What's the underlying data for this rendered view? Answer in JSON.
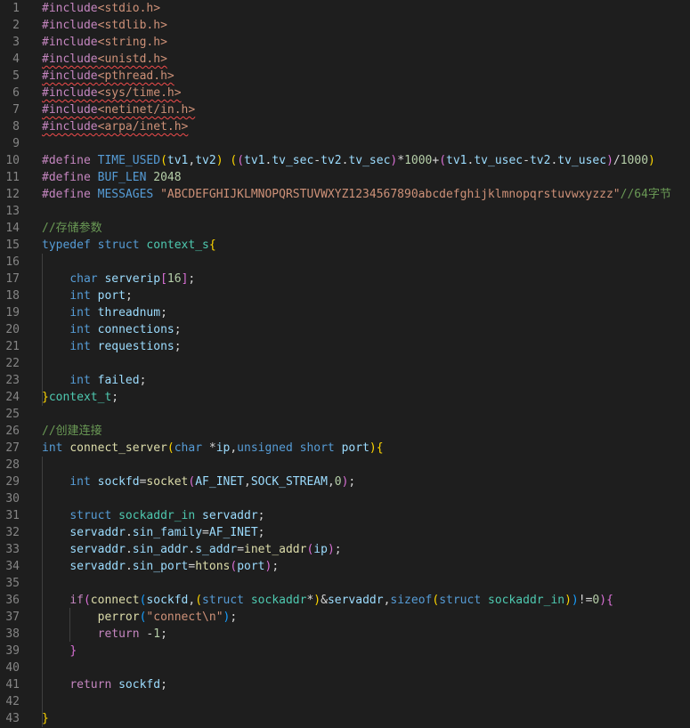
{
  "editor": {
    "colors": {
      "background": "#1e1e1e",
      "line_number": "#858585",
      "keyword": "#569cd6",
      "control": "#c586c0",
      "string": "#ce9178",
      "number": "#b5cea8",
      "comment": "#6a9955",
      "function": "#dcdcaa",
      "type": "#4ec9b0",
      "variable": "#9cdcfe",
      "error_squiggle": "#f14c4c"
    },
    "lines": [
      {
        "n": "1",
        "tokens": [
          [
            "#include",
            "ctl"
          ],
          [
            "<stdio.h>",
            "str"
          ]
        ]
      },
      {
        "n": "2",
        "tokens": [
          [
            "#include",
            "ctl"
          ],
          [
            "<stdlib.h>",
            "str"
          ]
        ]
      },
      {
        "n": "3",
        "tokens": [
          [
            "#include",
            "ctl"
          ],
          [
            "<string.h>",
            "str"
          ]
        ]
      },
      {
        "n": "4",
        "tokens": [
          [
            "#include",
            "ctl",
            "squiggle"
          ],
          [
            "<unistd.h>",
            "str",
            "squiggle"
          ]
        ]
      },
      {
        "n": "5",
        "tokens": [
          [
            "#include",
            "ctl",
            "squiggle"
          ],
          [
            "<pthread.h>",
            "str",
            "squiggle"
          ]
        ]
      },
      {
        "n": "6",
        "tokens": [
          [
            "#include",
            "ctl",
            "squiggle"
          ],
          [
            "<sys/time.h>",
            "str",
            "squiggle"
          ]
        ]
      },
      {
        "n": "7",
        "tokens": [
          [
            "#include",
            "ctl",
            "squiggle"
          ],
          [
            "<netinet/in.h>",
            "str",
            "squiggle"
          ]
        ]
      },
      {
        "n": "8",
        "tokens": [
          [
            "#include",
            "ctl",
            "squiggle"
          ],
          [
            "<arpa/inet.h>",
            "str",
            "squiggle"
          ]
        ]
      },
      {
        "n": "9",
        "tokens": []
      },
      {
        "n": "10",
        "tokens": [
          [
            "#define",
            "ctl"
          ],
          [
            " ",
            "txt"
          ],
          [
            "TIME_USED",
            "mac"
          ],
          [
            "(",
            "br1"
          ],
          [
            "tv1",
            "var"
          ],
          [
            ",",
            "txt"
          ],
          [
            "tv2",
            "var"
          ],
          [
            ")",
            "br1"
          ],
          [
            " ",
            "txt"
          ],
          [
            "(",
            "br1"
          ],
          [
            "(",
            "br2"
          ],
          [
            "tv1",
            "var"
          ],
          [
            ".",
            "txt"
          ],
          [
            "tv_sec",
            "var"
          ],
          [
            "-",
            "txt"
          ],
          [
            "tv2",
            "var"
          ],
          [
            ".",
            "txt"
          ],
          [
            "tv_sec",
            "var"
          ],
          [
            ")",
            "br2"
          ],
          [
            "*",
            "txt"
          ],
          [
            "1000",
            "num"
          ],
          [
            "+",
            "txt"
          ],
          [
            "(",
            "br2"
          ],
          [
            "tv1",
            "var"
          ],
          [
            ".",
            "txt"
          ],
          [
            "tv_usec",
            "var"
          ],
          [
            "-",
            "txt"
          ],
          [
            "tv2",
            "var"
          ],
          [
            ".",
            "txt"
          ],
          [
            "tv_usec",
            "var"
          ],
          [
            ")",
            "br2"
          ],
          [
            "/",
            "txt"
          ],
          [
            "1000",
            "num"
          ],
          [
            ")",
            "br1"
          ]
        ]
      },
      {
        "n": "11",
        "tokens": [
          [
            "#define",
            "ctl"
          ],
          [
            " ",
            "txt"
          ],
          [
            "BUF_LEN",
            "mac"
          ],
          [
            " ",
            "txt"
          ],
          [
            "2048",
            "num"
          ]
        ]
      },
      {
        "n": "12",
        "tokens": [
          [
            "#define",
            "ctl"
          ],
          [
            " ",
            "txt"
          ],
          [
            "MESSAGES",
            "mac"
          ],
          [
            " ",
            "txt"
          ],
          [
            "\"ABCDEFGHIJKLMNOPQRSTUVWXYZ1234567890abcdefghijklmnopqrstuvwxyzzz\"",
            "str"
          ],
          [
            "//64字节",
            "com"
          ]
        ]
      },
      {
        "n": "13",
        "tokens": []
      },
      {
        "n": "14",
        "tokens": [
          [
            "//存储参数",
            "com"
          ]
        ]
      },
      {
        "n": "15",
        "tokens": [
          [
            "typedef",
            "kw"
          ],
          [
            " ",
            "txt"
          ],
          [
            "struct",
            "kw"
          ],
          [
            " ",
            "txt"
          ],
          [
            "context_s",
            "type"
          ],
          [
            "{",
            "br1"
          ]
        ]
      },
      {
        "n": "16",
        "tokens": []
      },
      {
        "n": "17",
        "tokens": [
          [
            "    ",
            "txt"
          ],
          [
            "char",
            "kw"
          ],
          [
            " ",
            "txt"
          ],
          [
            "serverip",
            "var"
          ],
          [
            "[",
            "br2"
          ],
          [
            "16",
            "num"
          ],
          [
            "]",
            "br2"
          ],
          [
            ";",
            "txt"
          ]
        ]
      },
      {
        "n": "18",
        "tokens": [
          [
            "    ",
            "txt"
          ],
          [
            "int",
            "kw"
          ],
          [
            " ",
            "txt"
          ],
          [
            "port",
            "var"
          ],
          [
            ";",
            "txt"
          ]
        ]
      },
      {
        "n": "19",
        "tokens": [
          [
            "    ",
            "txt"
          ],
          [
            "int",
            "kw"
          ],
          [
            " ",
            "txt"
          ],
          [
            "threadnum",
            "var"
          ],
          [
            ";",
            "txt"
          ]
        ]
      },
      {
        "n": "20",
        "tokens": [
          [
            "    ",
            "txt"
          ],
          [
            "int",
            "kw"
          ],
          [
            " ",
            "txt"
          ],
          [
            "connections",
            "var"
          ],
          [
            ";",
            "txt"
          ]
        ]
      },
      {
        "n": "21",
        "tokens": [
          [
            "    ",
            "txt"
          ],
          [
            "int",
            "kw"
          ],
          [
            " ",
            "txt"
          ],
          [
            "requestions",
            "var"
          ],
          [
            ";",
            "txt"
          ]
        ]
      },
      {
        "n": "22",
        "tokens": []
      },
      {
        "n": "23",
        "tokens": [
          [
            "    ",
            "txt"
          ],
          [
            "int",
            "kw"
          ],
          [
            " ",
            "txt"
          ],
          [
            "failed",
            "var"
          ],
          [
            ";",
            "txt"
          ]
        ]
      },
      {
        "n": "24",
        "tokens": [
          [
            "}",
            "br1"
          ],
          [
            "context_t",
            "type"
          ],
          [
            ";",
            "txt"
          ]
        ]
      },
      {
        "n": "25",
        "tokens": []
      },
      {
        "n": "26",
        "tokens": [
          [
            "//创建连接",
            "com"
          ]
        ]
      },
      {
        "n": "27",
        "tokens": [
          [
            "int",
            "kw"
          ],
          [
            " ",
            "txt"
          ],
          [
            "connect_server",
            "fn"
          ],
          [
            "(",
            "br1"
          ],
          [
            "char",
            "kw"
          ],
          [
            " *",
            "txt"
          ],
          [
            "ip",
            "var"
          ],
          [
            ",",
            "txt"
          ],
          [
            "unsigned",
            "kw"
          ],
          [
            " ",
            "txt"
          ],
          [
            "short",
            "kw"
          ],
          [
            " ",
            "txt"
          ],
          [
            "port",
            "var"
          ],
          [
            ")",
            "br1"
          ],
          [
            "{",
            "br1"
          ]
        ]
      },
      {
        "n": "28",
        "tokens": []
      },
      {
        "n": "29",
        "tokens": [
          [
            "    ",
            "txt"
          ],
          [
            "int",
            "kw"
          ],
          [
            " ",
            "txt"
          ],
          [
            "sockfd",
            "var"
          ],
          [
            "=",
            "txt"
          ],
          [
            "socket",
            "fn"
          ],
          [
            "(",
            "br2"
          ],
          [
            "AF_INET",
            "var"
          ],
          [
            ",",
            "txt"
          ],
          [
            "SOCK_STREAM",
            "var"
          ],
          [
            ",",
            "txt"
          ],
          [
            "0",
            "num"
          ],
          [
            ")",
            "br2"
          ],
          [
            ";",
            "txt"
          ]
        ]
      },
      {
        "n": "30",
        "tokens": []
      },
      {
        "n": "31",
        "tokens": [
          [
            "    ",
            "txt"
          ],
          [
            "struct",
            "kw"
          ],
          [
            " ",
            "txt"
          ],
          [
            "sockaddr_in",
            "type"
          ],
          [
            " ",
            "txt"
          ],
          [
            "servaddr",
            "var"
          ],
          [
            ";",
            "txt"
          ]
        ]
      },
      {
        "n": "32",
        "tokens": [
          [
            "    ",
            "txt"
          ],
          [
            "servaddr",
            "var"
          ],
          [
            ".",
            "txt"
          ],
          [
            "sin_family",
            "var"
          ],
          [
            "=",
            "txt"
          ],
          [
            "AF_INET",
            "var"
          ],
          [
            ";",
            "txt"
          ]
        ]
      },
      {
        "n": "33",
        "tokens": [
          [
            "    ",
            "txt"
          ],
          [
            "servaddr",
            "var"
          ],
          [
            ".",
            "txt"
          ],
          [
            "sin_addr",
            "var"
          ],
          [
            ".",
            "txt"
          ],
          [
            "s_addr",
            "var"
          ],
          [
            "=",
            "txt"
          ],
          [
            "inet_addr",
            "fn"
          ],
          [
            "(",
            "br2"
          ],
          [
            "ip",
            "var"
          ],
          [
            ")",
            "br2"
          ],
          [
            ";",
            "txt"
          ]
        ]
      },
      {
        "n": "34",
        "tokens": [
          [
            "    ",
            "txt"
          ],
          [
            "servaddr",
            "var"
          ],
          [
            ".",
            "txt"
          ],
          [
            "sin_port",
            "var"
          ],
          [
            "=",
            "txt"
          ],
          [
            "htons",
            "fn"
          ],
          [
            "(",
            "br2"
          ],
          [
            "port",
            "var"
          ],
          [
            ")",
            "br2"
          ],
          [
            ";",
            "txt"
          ]
        ]
      },
      {
        "n": "35",
        "tokens": []
      },
      {
        "n": "36",
        "tokens": [
          [
            "    ",
            "txt"
          ],
          [
            "if",
            "ctl"
          ],
          [
            "(",
            "br2"
          ],
          [
            "connect",
            "fn"
          ],
          [
            "(",
            "br3"
          ],
          [
            "sockfd",
            "var"
          ],
          [
            ",",
            "txt"
          ],
          [
            "(",
            "br1"
          ],
          [
            "struct",
            "kw"
          ],
          [
            " ",
            "txt"
          ],
          [
            "sockaddr",
            "type"
          ],
          [
            "*",
            "txt"
          ],
          [
            ")",
            "br1"
          ],
          [
            "&",
            "txt"
          ],
          [
            "servaddr",
            "var"
          ],
          [
            ",",
            "txt"
          ],
          [
            "sizeof",
            "kw"
          ],
          [
            "(",
            "br1"
          ],
          [
            "struct",
            "kw"
          ],
          [
            " ",
            "txt"
          ],
          [
            "sockaddr_in",
            "type"
          ],
          [
            ")",
            "br1"
          ],
          [
            ")",
            "br3"
          ],
          [
            "!=",
            "txt"
          ],
          [
            "0",
            "num"
          ],
          [
            ")",
            "br2"
          ],
          [
            "{",
            "br2"
          ]
        ]
      },
      {
        "n": "37",
        "tokens": [
          [
            "        ",
            "txt"
          ],
          [
            "perror",
            "fn"
          ],
          [
            "(",
            "br3"
          ],
          [
            "\"connect\\n\"",
            "str"
          ],
          [
            ")",
            "br3"
          ],
          [
            ";",
            "txt"
          ]
        ]
      },
      {
        "n": "38",
        "tokens": [
          [
            "        ",
            "txt"
          ],
          [
            "return",
            "ctl"
          ],
          [
            " -",
            "txt"
          ],
          [
            "1",
            "num"
          ],
          [
            ";",
            "txt"
          ]
        ]
      },
      {
        "n": "39",
        "tokens": [
          [
            "    ",
            "txt"
          ],
          [
            "}",
            "br2"
          ]
        ]
      },
      {
        "n": "40",
        "tokens": []
      },
      {
        "n": "41",
        "tokens": [
          [
            "    ",
            "txt"
          ],
          [
            "return",
            "ctl"
          ],
          [
            " ",
            "txt"
          ],
          [
            "sockfd",
            "var"
          ],
          [
            ";",
            "txt"
          ]
        ]
      },
      {
        "n": "42",
        "tokens": []
      },
      {
        "n": "43",
        "tokens": [
          [
            "}",
            "br1"
          ]
        ]
      }
    ]
  }
}
